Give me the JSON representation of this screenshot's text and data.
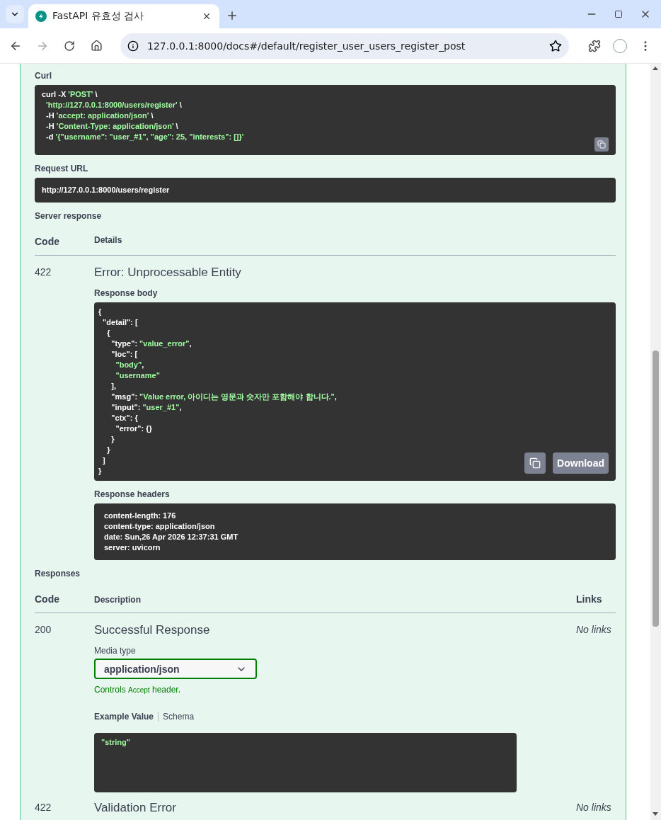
{
  "browser": {
    "tab_title": "FastAPI 유효성 검사",
    "address": "127.0.0.1:8000/docs#/default/register_user_users_register_post"
  },
  "curl": {
    "label": "Curl",
    "lines": [
      [
        {
          "text": "curl -X ",
          "kind": "plain"
        },
        {
          "text": "'POST'",
          "kind": "string"
        },
        {
          "text": " \\",
          "kind": "plain"
        }
      ],
      [
        {
          "text": "  'http://127.0.0.1:8000/users/register'",
          "kind": "string"
        },
        {
          "text": " \\",
          "kind": "plain"
        }
      ],
      [
        {
          "text": "  -H ",
          "kind": "plain"
        },
        {
          "text": "'accept: application/json'",
          "kind": "string"
        },
        {
          "text": " \\",
          "kind": "plain"
        }
      ],
      [
        {
          "text": "  -H ",
          "kind": "plain"
        },
        {
          "text": "'Content-Type: application/json'",
          "kind": "string"
        },
        {
          "text": " \\",
          "kind": "plain"
        }
      ],
      [
        {
          "text": "  -d ",
          "kind": "plain"
        },
        {
          "text": "'{\"username\": \"user_#1\", \"age\": 25, \"interests\": []}'",
          "kind": "string"
        }
      ]
    ]
  },
  "request_url": {
    "label": "Request URL",
    "value": "http://127.0.0.1:8000/users/register"
  },
  "server_response": {
    "label": "Server response",
    "columns": [
      "Code",
      "Details"
    ],
    "code": "422",
    "title": "Error: Unprocessable Entity",
    "body_label": "Response body",
    "body_lines": [
      [
        {
          "text": "{",
          "kind": "plain"
        }
      ],
      [
        {
          "text": "  \"detail\": [",
          "kind": "plain"
        }
      ],
      [
        {
          "text": "    {",
          "kind": "plain"
        }
      ],
      [
        {
          "text": "      \"type\": ",
          "kind": "plain"
        },
        {
          "text": "\"value_error\"",
          "kind": "string"
        },
        {
          "text": ",",
          "kind": "plain"
        }
      ],
      [
        {
          "text": "      \"loc\": [",
          "kind": "plain"
        }
      ],
      [
        {
          "text": "        \"body\"",
          "kind": "string"
        },
        {
          "text": ",",
          "kind": "plain"
        }
      ],
      [
        {
          "text": "        \"username\"",
          "kind": "string"
        }
      ],
      [
        {
          "text": "      ],",
          "kind": "plain"
        }
      ],
      [
        {
          "text": "      \"msg\": ",
          "kind": "plain"
        },
        {
          "text": "\"Value error, 아이디는 영문과 숫자만 포함해야 합니다.\"",
          "kind": "string"
        },
        {
          "text": ",",
          "kind": "plain"
        }
      ],
      [
        {
          "text": "      \"input\": ",
          "kind": "plain"
        },
        {
          "text": "\"user_#1\"",
          "kind": "string"
        },
        {
          "text": ",",
          "kind": "plain"
        }
      ],
      [
        {
          "text": "      \"ctx\": {",
          "kind": "plain"
        }
      ],
      [
        {
          "text": "        \"error\": {}",
          "kind": "plain"
        }
      ],
      [
        {
          "text": "      }",
          "kind": "plain"
        }
      ],
      [
        {
          "text": "    }",
          "kind": "plain"
        }
      ],
      [
        {
          "text": "  ]",
          "kind": "plain"
        }
      ],
      [
        {
          "text": "}",
          "kind": "plain"
        }
      ]
    ],
    "download": "Download",
    "headers_label": "Response headers",
    "headers": [
      "content-length: 176",
      "content-type: application/json",
      "date: Sun,26 Apr 2026 12:37:31 GMT",
      "server: uvicorn"
    ]
  },
  "responses": {
    "label": "Responses",
    "columns": [
      "Code",
      "Description",
      "Links"
    ],
    "rows": [
      {
        "code": "200",
        "description": "Successful Response",
        "links": "No links",
        "media_type_label": "Media type",
        "media_type": "application/json",
        "controls_note": [
          "Controls",
          "Accept",
          "header."
        ],
        "example_tabs": [
          {
            "label": "Example Value",
            "selected": true
          },
          {
            "label": "Schema",
            "selected": false
          }
        ],
        "example": "\"string\""
      },
      {
        "code": "422",
        "description": "Validation Error",
        "links": "No links"
      }
    ]
  }
}
